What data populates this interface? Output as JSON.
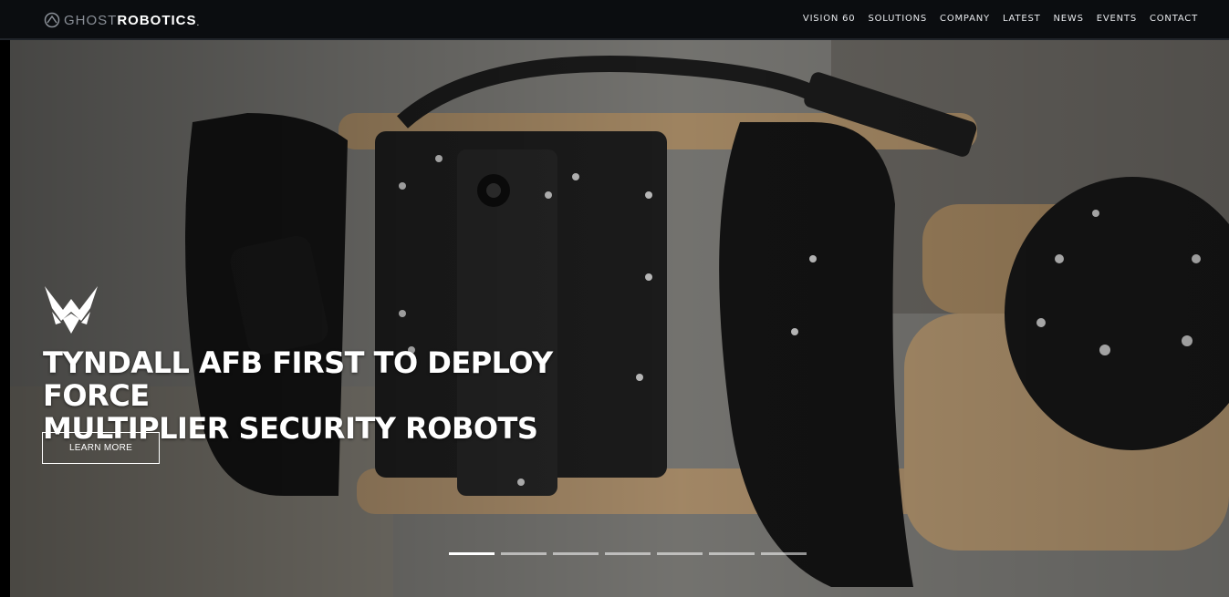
{
  "brand": {
    "ghost": "GHOST",
    "robotics": "ROBOTICS",
    "dot": "."
  },
  "nav": {
    "items": [
      "VISION 60",
      "SOLUTIONS",
      "COMPANY",
      "LATEST",
      "NEWS",
      "EVENTS",
      "CONTACT"
    ]
  },
  "hero": {
    "headline_line1": "TYNDALL AFB FIRST TO DEPLOY FORCE",
    "headline_line2": "MULTIPLIER SECURITY ROBOTS",
    "cta_label": "LEARN MORE",
    "slides_total": 7,
    "active_slide": 1
  },
  "colors": {
    "header_bg": "#0b0d10",
    "text": "#ffffff",
    "robot_tan": "#b0926b",
    "robot_black": "#1a1a1a"
  },
  "icons": [
    "ghost-robotics-logo-icon",
    "air-force-emblem-icon"
  ]
}
